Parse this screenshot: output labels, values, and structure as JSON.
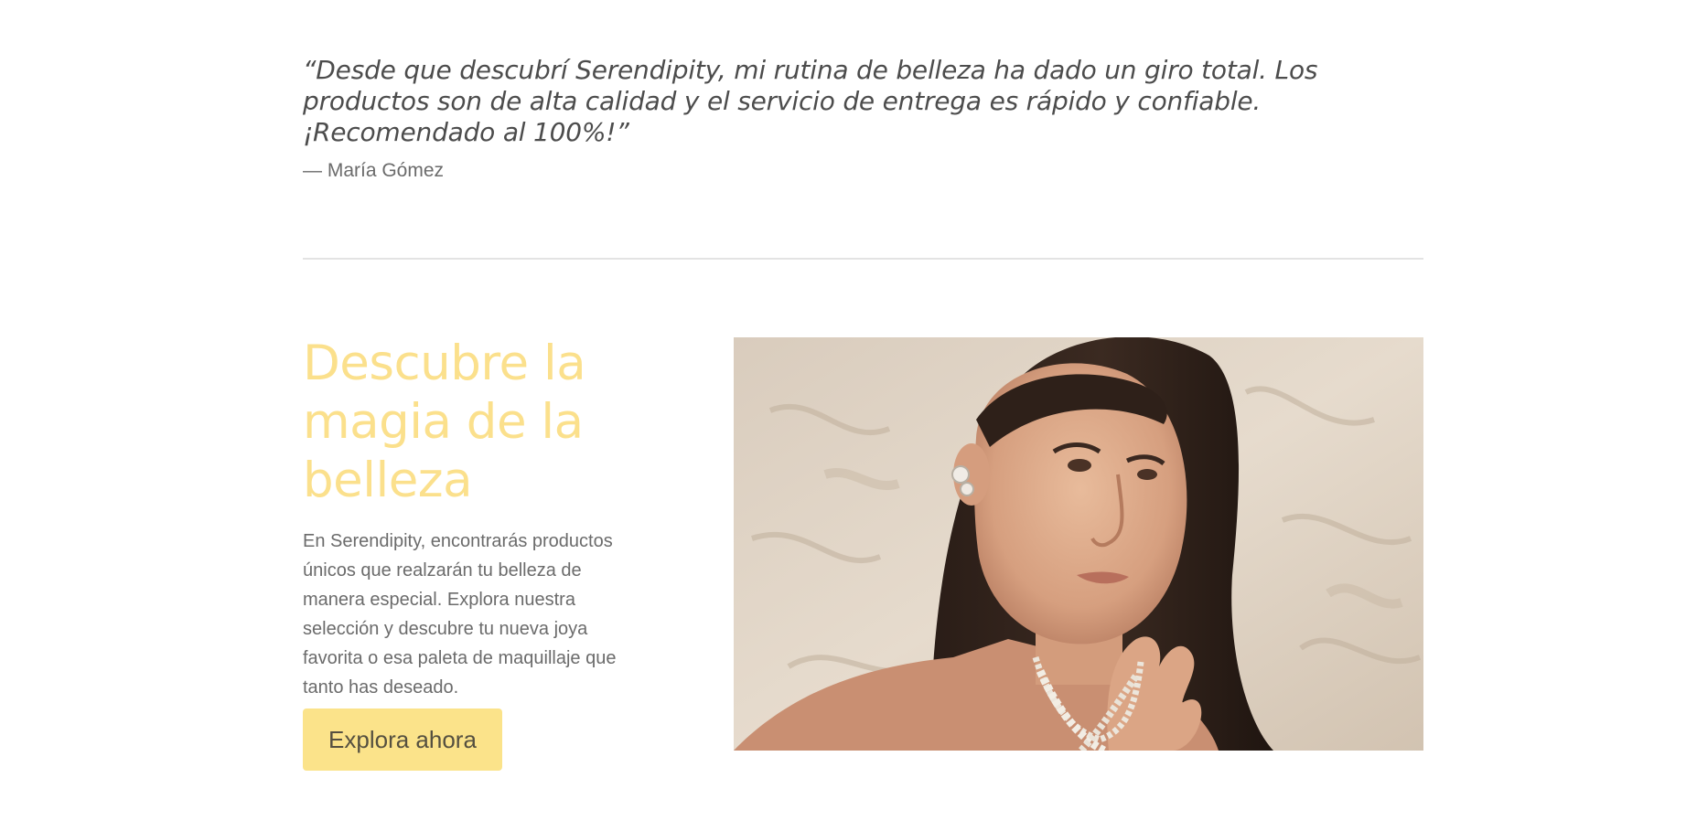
{
  "testimonial": {
    "quote": "“Desde que descubrí Serendipity, mi rutina de belleza ha dado un giro total. Los productos son de alta calidad y el servicio de entrega es rápido y confiable. ¡Recomendado al 100%!”",
    "author": "— María Gómez"
  },
  "promo": {
    "heading": "Descubre la magia de la belleza",
    "text": "En Serendipity, encontrarás productos únicos que realzarán tu belleza de manera especial. Explora nuestra selección y descubre tu nueva joya favorita o esa paleta de maquillaje que tanto has deseado.",
    "button_label": "Explora ahora"
  },
  "colors": {
    "heading_accent": "#fbe08c",
    "button_background": "#fbe38a",
    "body_text": "#6b6b6b",
    "divider": "#e3e3e3"
  },
  "image": {
    "subject": "model-with-earrings-and-necklace-photo"
  }
}
